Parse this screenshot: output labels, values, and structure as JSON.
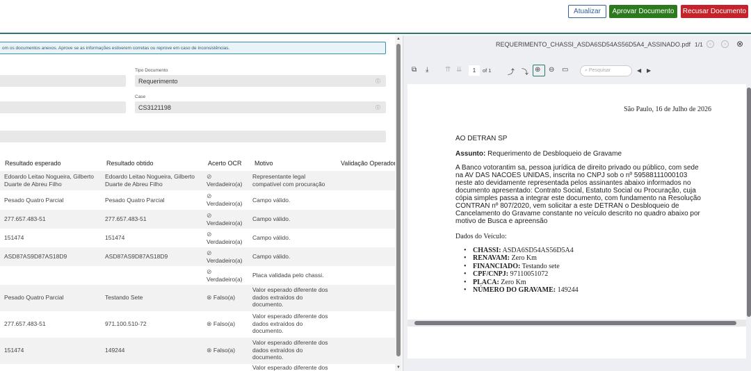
{
  "header": {
    "refresh_label": "Atualizar",
    "approve_label": "Aprovar Documento",
    "reject_label": "Recusar Documento"
  },
  "left": {
    "info_text": "om os documentos anexos. Aprove se as informações estiverem corretas ou reprove em caso de inconsistências.",
    "tipo_label": "Tipo Documento",
    "tipo_value": "Requerimento",
    "case_label": "Case",
    "case_value": "CS3121198",
    "columns": [
      "Resultado esperado",
      "Resultado obtido",
      "Acerto OCR",
      "Motivo",
      "Validação Operador"
    ],
    "rows": [
      {
        "expected": "Edoardo Leitao Nogueira, Gilberto Duarte de Abreu Filho",
        "obtained": "Edoardo Leitao Nogueira, Gilberto Duarte de Abreu Filho",
        "ocr": "Verdadeiro(a)",
        "ok": true,
        "reason": "Representante legal compatível com procuração"
      },
      {
        "expected": "Pesado Quatro Parcial",
        "obtained": "Pesado Quatro Parcial",
        "ocr": "Verdadeiro(a)",
        "ok": true,
        "reason": "Campo válido."
      },
      {
        "expected": "277.657.483-51",
        "obtained": "277.657.483-51",
        "ocr": "Verdadeiro(a)",
        "ok": true,
        "reason": "Campo válido."
      },
      {
        "expected": "151474",
        "obtained": "151474",
        "ocr": "Verdadeiro(a)",
        "ok": true,
        "reason": "Campo válido."
      },
      {
        "expected": "ASD87AS9D87AS18D9",
        "obtained": "ASD87AS9D87AS18D9",
        "ocr": "Verdadeiro(a)",
        "ok": true,
        "reason": "Campo válido."
      },
      {
        "expected": "",
        "obtained": "",
        "ocr": "Verdadeiro(a)",
        "ok": true,
        "reason": "Placa validada pelo chassi."
      },
      {
        "expected": "Pesado Quatro Parcial",
        "obtained": "Testando Sete",
        "ocr": "Falso(a)",
        "ok": false,
        "reason": "Valor esperado diferente dos dados extraídos do documento."
      },
      {
        "expected": "277.657.483-51",
        "obtained": "971.100.510-72",
        "ocr": "Falso(a)",
        "ok": false,
        "reason": "Valor esperado diferente dos dados extraídos do documento."
      },
      {
        "expected": "151474",
        "obtained": "149244",
        "ocr": "Falso(a)",
        "ok": false,
        "reason": "Valor esperado diferente dos dados extraídos do documento."
      },
      {
        "expected": "",
        "obtained": "",
        "ocr": "",
        "ok": false,
        "reason": "Valor esperado diferente dos"
      }
    ]
  },
  "viewer": {
    "file_name": "REQUERIMENTO_CHASSI_ASDA6SD54AS56D5A4_ASSINADO.pdf",
    "pages": "1/1",
    "page_input": "1",
    "page_of": "of 1",
    "search_placeholder": "Pesquisar",
    "doc": {
      "date": "São Paulo, 16 de Julho de 2026",
      "to": "AO DETRAN SP",
      "subject_label": "Assunto:",
      "subject": " Requerimento de Desbloqueio de Gravame",
      "body": "A Banco votorantim sa, pessoa jurídica de direito privado ou público, com sede na AV DAS NACOES UNIDAS, inscrita no CNPJ sob o nº 59588111000103 neste ato devidamente representada pelos assinantes abaixo informados no documento apresentado: Contrato Social, Estatuto Social ou Procuração, cuja cópia simples passa a integrar este documento, com fundamento na Resolução CONTRAN nº 807/2020, vem solicitar a este DETRAN o Desbloqueio de Cancelamento do Gravame constante no veículo descrito no quadro abaixo por motivo de Busca e apreensão",
      "dados": "Dados do Veículo:",
      "items": [
        {
          "k": "CHASSI:",
          "v": " ASDA6SD54AS56D5A4"
        },
        {
          "k": "RENAVAM:",
          "v": " Zero Km"
        },
        {
          "k": "FINANCIADO:",
          "v": " Testando sete"
        },
        {
          "k": "CPF/CNPJ:",
          "v": " 97110051072"
        },
        {
          "k": "PLACA:",
          "v": " Zero Km"
        },
        {
          "k": "NÚMERO DO GRAVAME:",
          "v": " 149244"
        }
      ]
    }
  }
}
